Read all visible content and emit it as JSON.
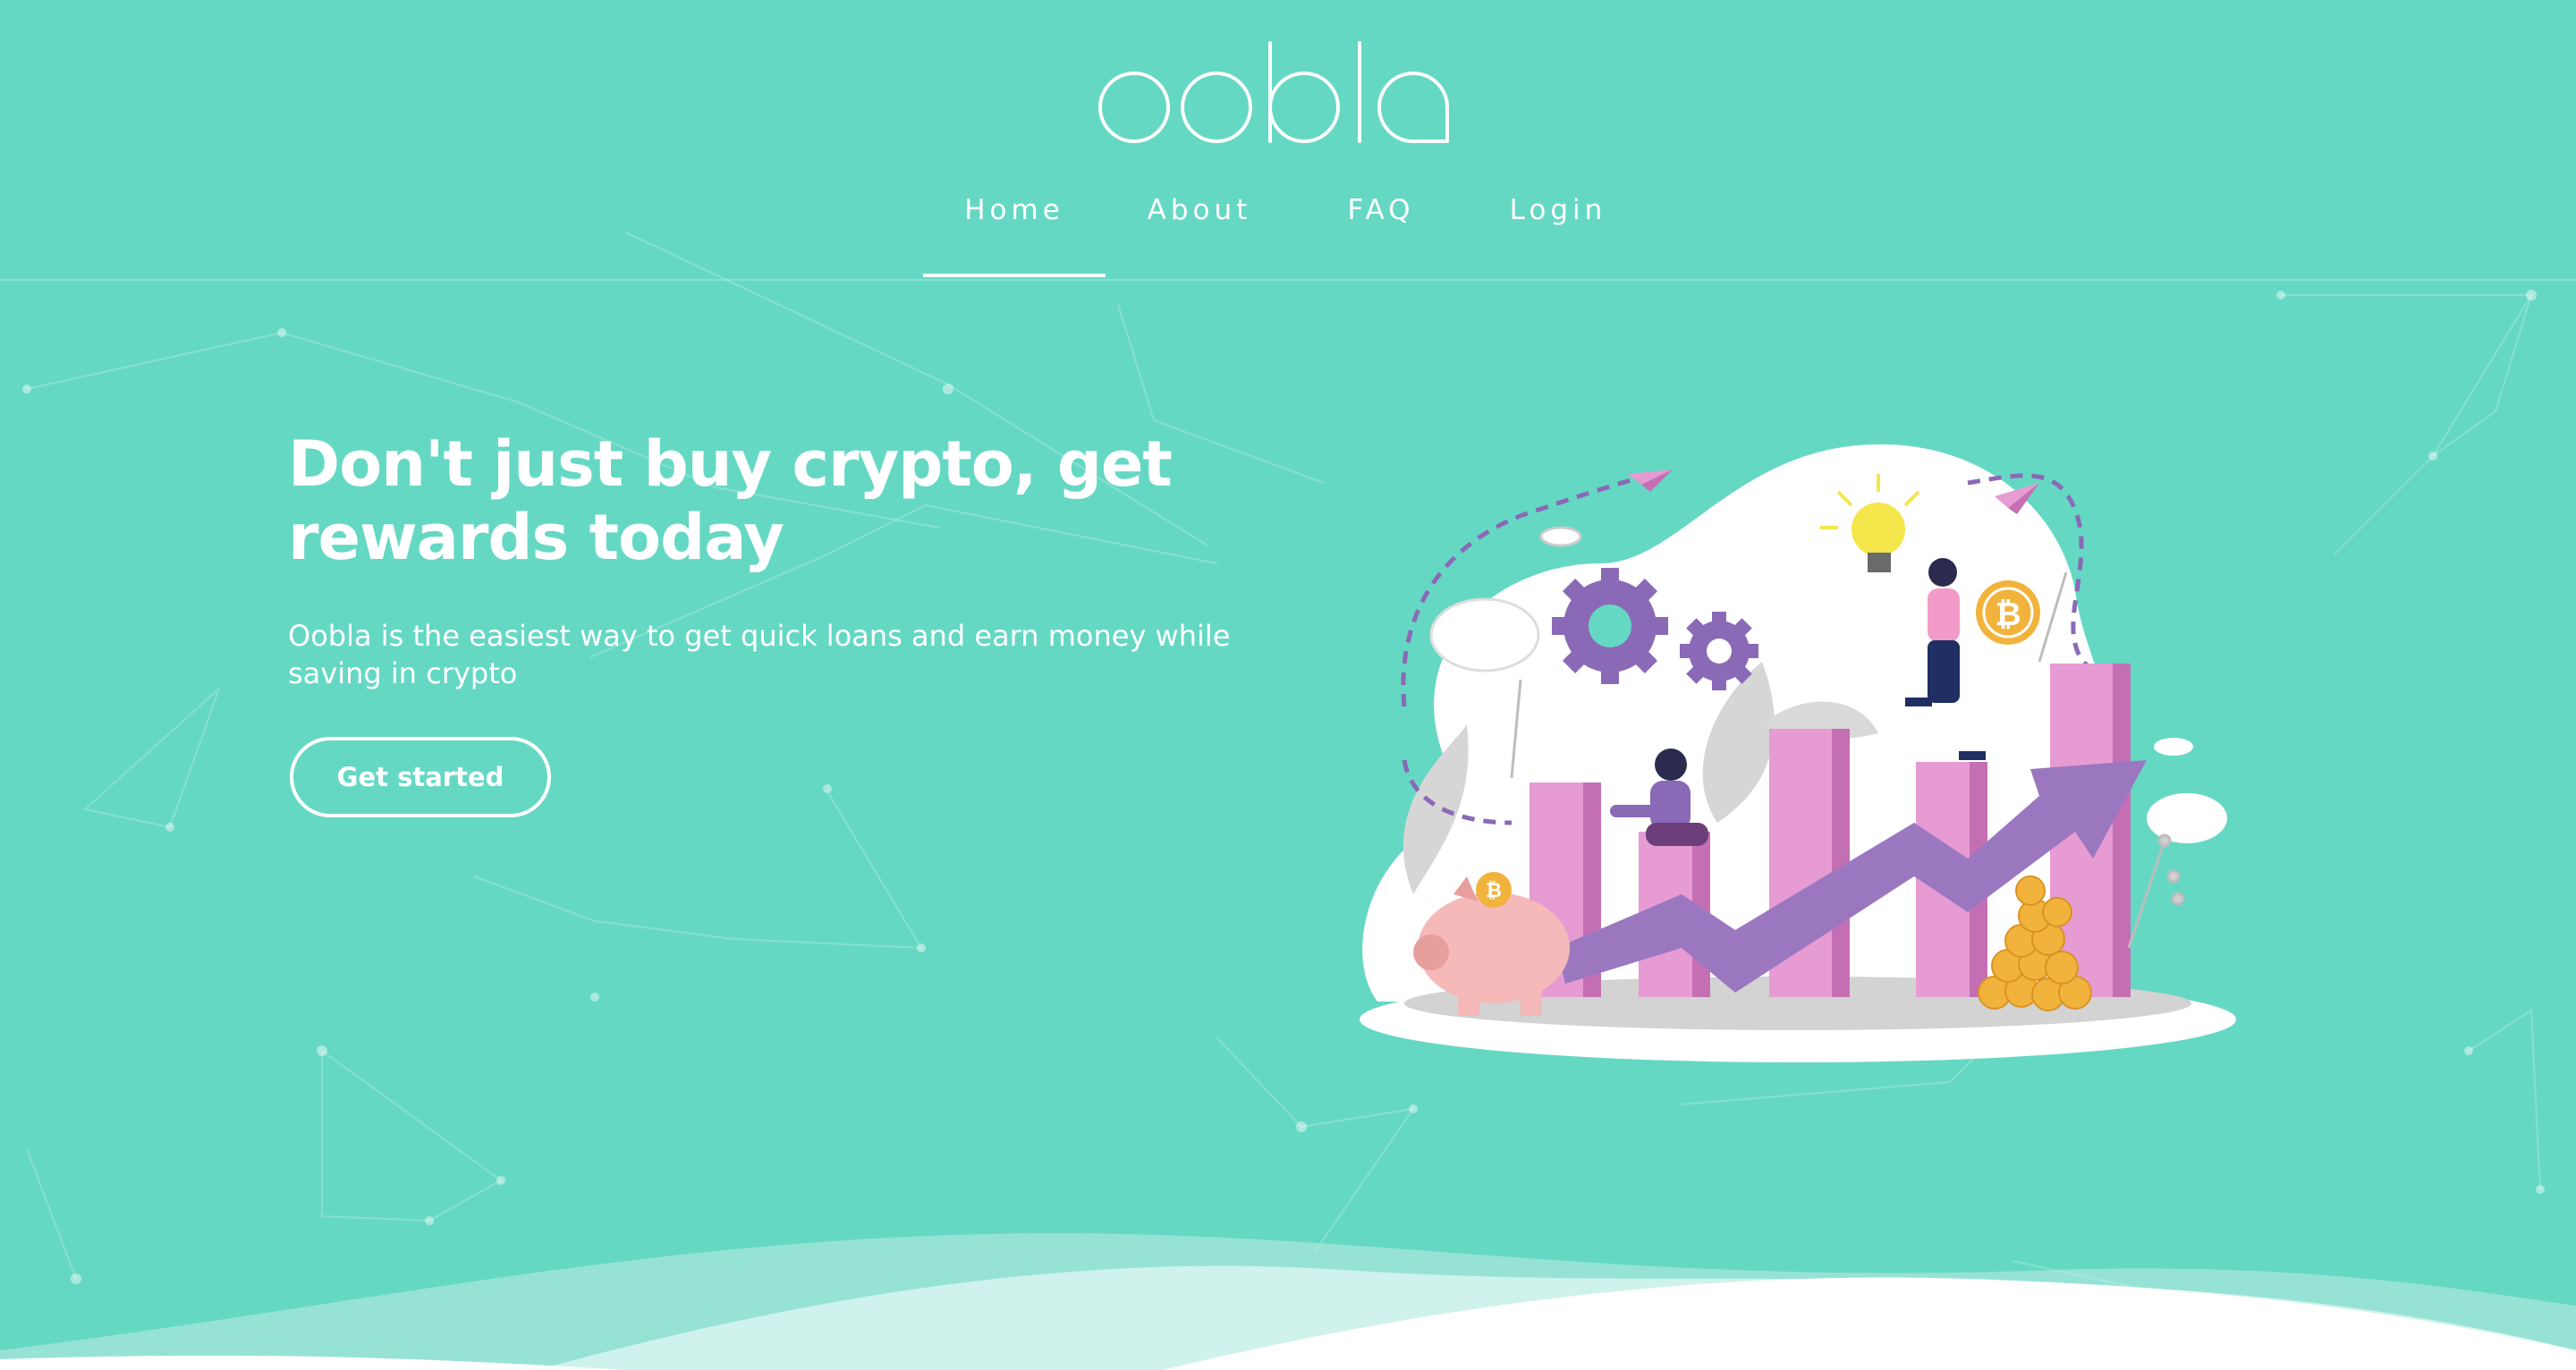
{
  "brand": {
    "logo_text": "oobla"
  },
  "nav": {
    "items": [
      {
        "label": "Home",
        "active": true
      },
      {
        "label": "About",
        "active": false
      },
      {
        "label": "FAQ",
        "active": false
      },
      {
        "label": "Login",
        "active": false
      }
    ]
  },
  "hero": {
    "title": "Don't just buy crypto, get rewards today",
    "subtitle": "Oobla is the easiest way to get quick loans and earn money while saving in crypto",
    "cta_label": "Get started"
  },
  "colors": {
    "background": "#65d8c4",
    "text": "#ffffff",
    "bars": "#e69bd3",
    "arrow": "#9b77c0",
    "coins": "#f2b33d"
  },
  "illustration": {
    "icons": [
      "paper-plane-icon",
      "gear-icon",
      "lightbulb-icon",
      "bitcoin-coin-icon",
      "piggy-bank-icon",
      "growth-arrow-icon"
    ]
  }
}
